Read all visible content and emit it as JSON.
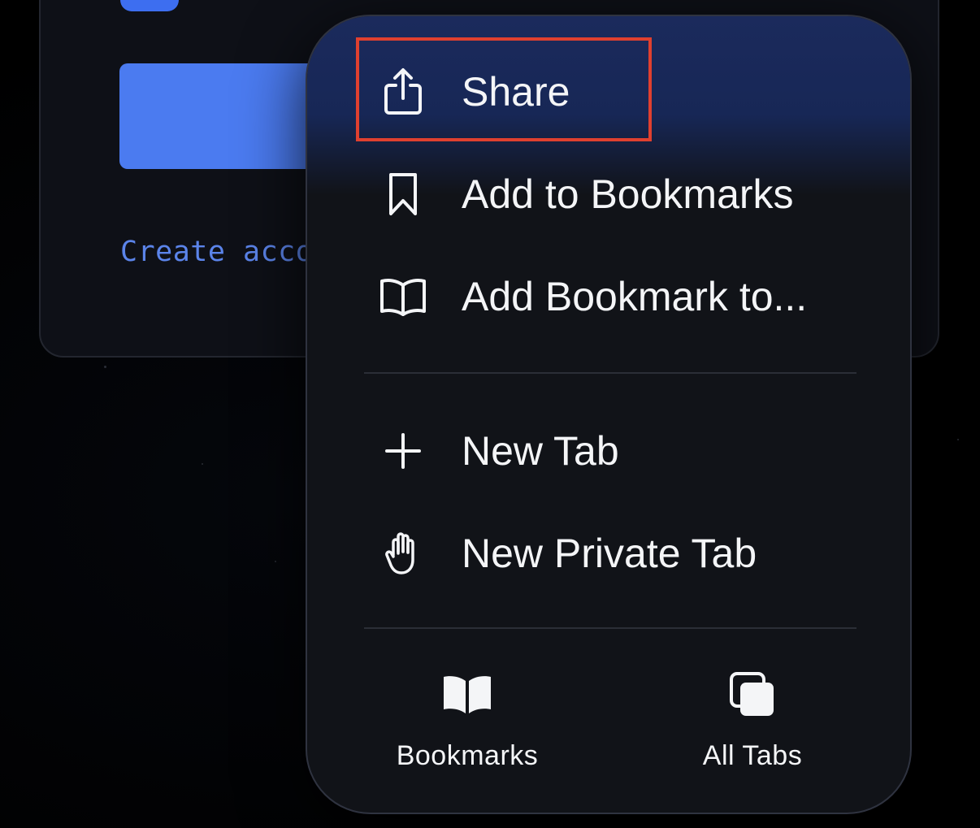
{
  "background": {
    "create_account_link": "Create accou",
    "accent_color": "#4b7bf0"
  },
  "menu": {
    "items": [
      {
        "label": "Share",
        "icon": "share-icon"
      },
      {
        "label": "Add to Bookmarks",
        "icon": "bookmark-icon"
      },
      {
        "label": "Add Bookmark to...",
        "icon": "open-book-icon"
      },
      {
        "label": "New Tab",
        "icon": "plus-icon"
      },
      {
        "label": "New Private Tab",
        "icon": "hand-icon"
      }
    ],
    "bottom": [
      {
        "label": "Bookmarks",
        "icon": "book-filled-icon"
      },
      {
        "label": "All Tabs",
        "icon": "tabs-icon"
      }
    ],
    "highlight_color": "#e0402f"
  }
}
